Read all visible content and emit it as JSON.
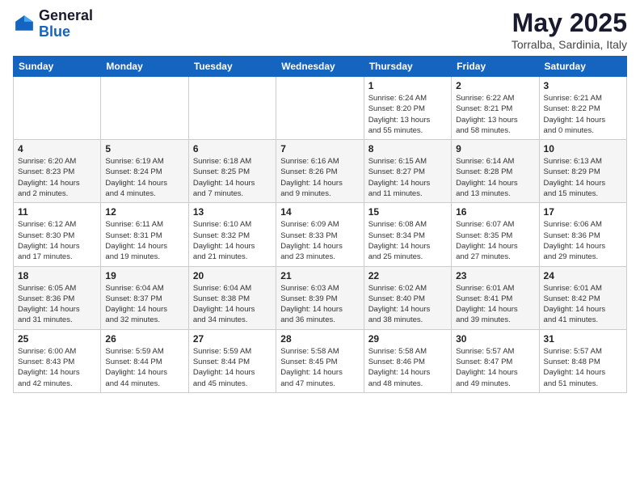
{
  "logo": {
    "general": "General",
    "blue": "Blue"
  },
  "title": {
    "month": "May 2025",
    "location": "Torralba, Sardinia, Italy"
  },
  "days_header": [
    "Sunday",
    "Monday",
    "Tuesday",
    "Wednesday",
    "Thursday",
    "Friday",
    "Saturday"
  ],
  "weeks": [
    [
      {
        "day": "",
        "info": ""
      },
      {
        "day": "",
        "info": ""
      },
      {
        "day": "",
        "info": ""
      },
      {
        "day": "",
        "info": ""
      },
      {
        "day": "1",
        "info": "Sunrise: 6:24 AM\nSunset: 8:20 PM\nDaylight: 13 hours\nand 55 minutes."
      },
      {
        "day": "2",
        "info": "Sunrise: 6:22 AM\nSunset: 8:21 PM\nDaylight: 13 hours\nand 58 minutes."
      },
      {
        "day": "3",
        "info": "Sunrise: 6:21 AM\nSunset: 8:22 PM\nDaylight: 14 hours\nand 0 minutes."
      }
    ],
    [
      {
        "day": "4",
        "info": "Sunrise: 6:20 AM\nSunset: 8:23 PM\nDaylight: 14 hours\nand 2 minutes."
      },
      {
        "day": "5",
        "info": "Sunrise: 6:19 AM\nSunset: 8:24 PM\nDaylight: 14 hours\nand 4 minutes."
      },
      {
        "day": "6",
        "info": "Sunrise: 6:18 AM\nSunset: 8:25 PM\nDaylight: 14 hours\nand 7 minutes."
      },
      {
        "day": "7",
        "info": "Sunrise: 6:16 AM\nSunset: 8:26 PM\nDaylight: 14 hours\nand 9 minutes."
      },
      {
        "day": "8",
        "info": "Sunrise: 6:15 AM\nSunset: 8:27 PM\nDaylight: 14 hours\nand 11 minutes."
      },
      {
        "day": "9",
        "info": "Sunrise: 6:14 AM\nSunset: 8:28 PM\nDaylight: 14 hours\nand 13 minutes."
      },
      {
        "day": "10",
        "info": "Sunrise: 6:13 AM\nSunset: 8:29 PM\nDaylight: 14 hours\nand 15 minutes."
      }
    ],
    [
      {
        "day": "11",
        "info": "Sunrise: 6:12 AM\nSunset: 8:30 PM\nDaylight: 14 hours\nand 17 minutes."
      },
      {
        "day": "12",
        "info": "Sunrise: 6:11 AM\nSunset: 8:31 PM\nDaylight: 14 hours\nand 19 minutes."
      },
      {
        "day": "13",
        "info": "Sunrise: 6:10 AM\nSunset: 8:32 PM\nDaylight: 14 hours\nand 21 minutes."
      },
      {
        "day": "14",
        "info": "Sunrise: 6:09 AM\nSunset: 8:33 PM\nDaylight: 14 hours\nand 23 minutes."
      },
      {
        "day": "15",
        "info": "Sunrise: 6:08 AM\nSunset: 8:34 PM\nDaylight: 14 hours\nand 25 minutes."
      },
      {
        "day": "16",
        "info": "Sunrise: 6:07 AM\nSunset: 8:35 PM\nDaylight: 14 hours\nand 27 minutes."
      },
      {
        "day": "17",
        "info": "Sunrise: 6:06 AM\nSunset: 8:36 PM\nDaylight: 14 hours\nand 29 minutes."
      }
    ],
    [
      {
        "day": "18",
        "info": "Sunrise: 6:05 AM\nSunset: 8:36 PM\nDaylight: 14 hours\nand 31 minutes."
      },
      {
        "day": "19",
        "info": "Sunrise: 6:04 AM\nSunset: 8:37 PM\nDaylight: 14 hours\nand 32 minutes."
      },
      {
        "day": "20",
        "info": "Sunrise: 6:04 AM\nSunset: 8:38 PM\nDaylight: 14 hours\nand 34 minutes."
      },
      {
        "day": "21",
        "info": "Sunrise: 6:03 AM\nSunset: 8:39 PM\nDaylight: 14 hours\nand 36 minutes."
      },
      {
        "day": "22",
        "info": "Sunrise: 6:02 AM\nSunset: 8:40 PM\nDaylight: 14 hours\nand 38 minutes."
      },
      {
        "day": "23",
        "info": "Sunrise: 6:01 AM\nSunset: 8:41 PM\nDaylight: 14 hours\nand 39 minutes."
      },
      {
        "day": "24",
        "info": "Sunrise: 6:01 AM\nSunset: 8:42 PM\nDaylight: 14 hours\nand 41 minutes."
      }
    ],
    [
      {
        "day": "25",
        "info": "Sunrise: 6:00 AM\nSunset: 8:43 PM\nDaylight: 14 hours\nand 42 minutes."
      },
      {
        "day": "26",
        "info": "Sunrise: 5:59 AM\nSunset: 8:44 PM\nDaylight: 14 hours\nand 44 minutes."
      },
      {
        "day": "27",
        "info": "Sunrise: 5:59 AM\nSunset: 8:44 PM\nDaylight: 14 hours\nand 45 minutes."
      },
      {
        "day": "28",
        "info": "Sunrise: 5:58 AM\nSunset: 8:45 PM\nDaylight: 14 hours\nand 47 minutes."
      },
      {
        "day": "29",
        "info": "Sunrise: 5:58 AM\nSunset: 8:46 PM\nDaylight: 14 hours\nand 48 minutes."
      },
      {
        "day": "30",
        "info": "Sunrise: 5:57 AM\nSunset: 8:47 PM\nDaylight: 14 hours\nand 49 minutes."
      },
      {
        "day": "31",
        "info": "Sunrise: 5:57 AM\nSunset: 8:48 PM\nDaylight: 14 hours\nand 51 minutes."
      }
    ]
  ]
}
